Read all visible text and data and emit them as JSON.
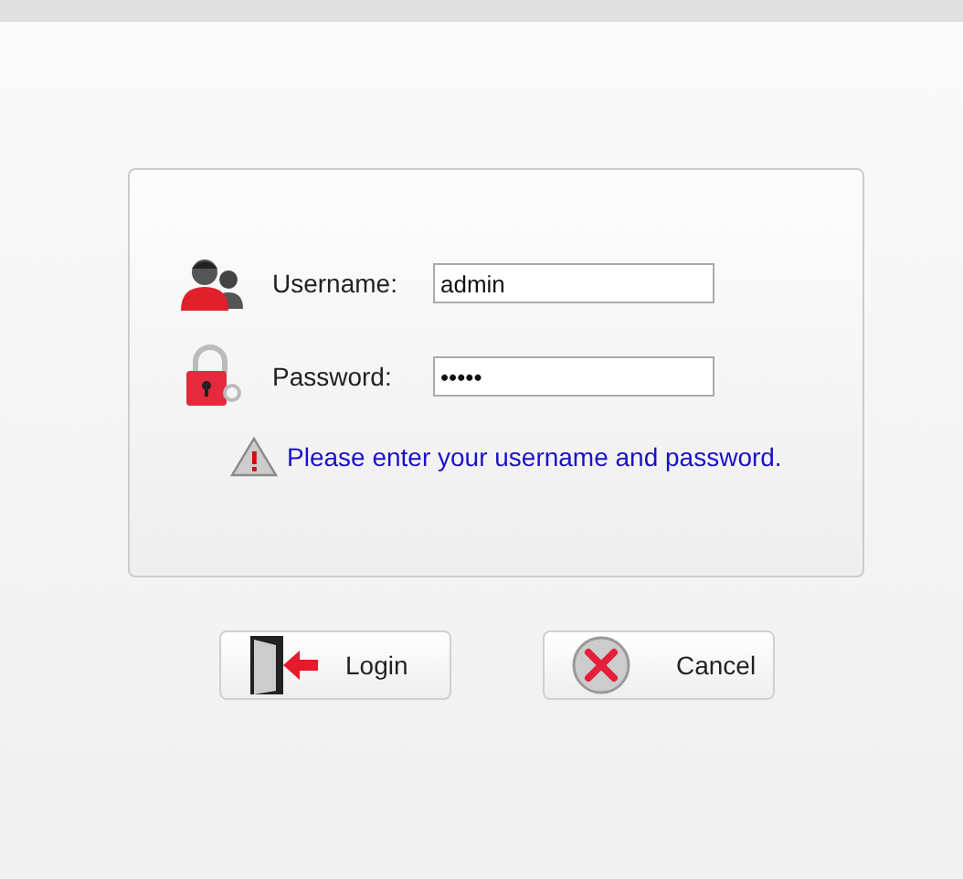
{
  "fields": [
    {
      "kind": "user",
      "label": "Username:",
      "value": "admin"
    },
    {
      "kind": "lock",
      "label": "Password:",
      "value": "•••••"
    }
  ],
  "message": {
    "text": "Please enter your username and password."
  },
  "buttons": [
    {
      "kind": "login",
      "label": "Login"
    },
    {
      "kind": "cancel",
      "label": "Cancel"
    }
  ]
}
